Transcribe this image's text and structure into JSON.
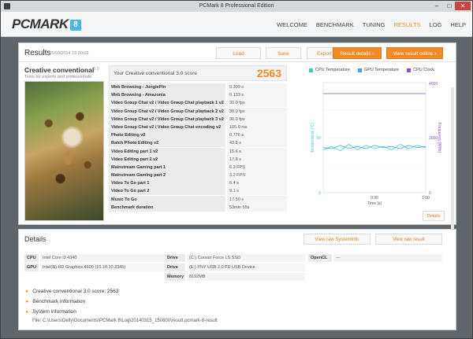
{
  "window": {
    "title": "PCMark 8 Professional Edition",
    "controls": {
      "minimize": "–",
      "maximize": "□",
      "close": "✕"
    }
  },
  "app": {
    "logo_text": "PCMARK",
    "logo_badge": "8",
    "nav": [
      "WELCOME",
      "BENCHMARK",
      "TUNING",
      "RESULTS",
      "LOG",
      "HELP"
    ],
    "active_nav": "RESULTS"
  },
  "results": {
    "heading": "Results",
    "date": "15/03/2014 16:00:03",
    "buttons": {
      "load": "Load",
      "save": "Save",
      "export": "Export",
      "result_details": "Result details",
      "view_online": "View result online"
    },
    "test_name": "Creative conventional",
    "test_version": "3.0",
    "test_subtitle": "Tests for experts and professionals",
    "score_label": "Your Creative conventional 3.0 score",
    "score_value": "2563",
    "rows": [
      {
        "name": "Web Browsing - JunglePin",
        "value": "0.309 s"
      },
      {
        "name": "Web Browsing - Amazonia",
        "value": "0.133 s"
      },
      {
        "name": "Video Group Chat v2 / Video Group Chat playback 1 v2",
        "value": "30.0 fps"
      },
      {
        "name": "Video Group Chat v2 / Video Group Chat playback 2 v2",
        "value": "30.0 fps"
      },
      {
        "name": "Video Group Chat v2 / Video Group Chat playback 3 v2",
        "value": "30.0 fps"
      },
      {
        "name": "Video Group Chat v2 / Video Group Chat encoding v2",
        "value": "105.0 ms"
      },
      {
        "name": "Photo Editing v2",
        "value": "0.776 s"
      },
      {
        "name": "Batch Photo Editing v2",
        "value": "43.8 s"
      },
      {
        "name": "Video Editing part 1 v2",
        "value": "15.6 s"
      },
      {
        "name": "Video Editing part 2 v2",
        "value": "17.8 s"
      },
      {
        "name": "Mainstream Gaming part 1",
        "value": "6.3 FPS"
      },
      {
        "name": "Mainstream Gaming part 2",
        "value": "3.2 FPS"
      },
      {
        "name": "Video To Go part 1",
        "value": "6.4 s"
      },
      {
        "name": "Video To Go part 2",
        "value": "9.1 s"
      },
      {
        "name": "Music To Go",
        "value": "17.50 s"
      },
      {
        "name": "Benchmark duration",
        "value": "53min 55s"
      }
    ],
    "details_button": "Details"
  },
  "chart_data": {
    "type": "line",
    "legend": [
      {
        "name": "CPU Temperature",
        "color": "#3ec9c9"
      },
      {
        "name": "GPU Temperature",
        "color": "#4aa3e0"
      },
      {
        "name": "CPU Clock",
        "color": "#8a4fc4"
      }
    ],
    "xlabel": "Time [s]",
    "ylabel_left": "Temperature [°C]",
    "ylabel_right": "Frequency [MHz]",
    "x_ticks": [
      "0:30",
      "1:00"
    ],
    "y_left_ticks": [
      "50",
      "0"
    ],
    "y_right_ticks": [
      "4000",
      "2000",
      "0"
    ],
    "ylim_left": [
      0,
      100
    ],
    "ylim_right": [
      0,
      4000
    ],
    "series": [
      {
        "name": "CPU Clock",
        "axis": "right",
        "x": [
          0,
          5,
          10,
          15,
          20,
          25,
          30,
          35,
          40,
          45,
          50,
          55,
          60
        ],
        "values": [
          3600,
          3600,
          3600,
          3600,
          3600,
          3600,
          3600,
          3600,
          3600,
          3600,
          3600,
          3600,
          3600
        ]
      },
      {
        "name": "CPU Temperature",
        "axis": "left",
        "x": [
          0,
          5,
          10,
          15,
          20,
          25,
          30,
          35,
          40,
          45,
          50,
          55,
          60
        ],
        "values": [
          39,
          42,
          38,
          44,
          39,
          43,
          40,
          42,
          39,
          44,
          40,
          43,
          41
        ]
      },
      {
        "name": "GPU Temperature",
        "axis": "left",
        "x": [
          0,
          5,
          10,
          15,
          20,
          25,
          30,
          35,
          40,
          45,
          50,
          55,
          60
        ],
        "values": [
          41,
          40,
          43,
          40,
          42,
          40,
          43,
          41,
          42,
          40,
          43,
          41,
          42
        ]
      }
    ]
  },
  "details": {
    "heading": "Details",
    "btn_sysinfo": "View raw SystemInfo",
    "btn_raw": "View raw result",
    "cpu_label": "CPU",
    "cpu_value": "Intel Core i3 4340",
    "gpu_label": "GPU",
    "gpu_value": "Intel(R) HD Graphics 4600 (10.18.10.3345)",
    "drive1_label": "Drive",
    "drive1_value": "(C:) Corsair Force LS SSD",
    "drive2_label": "Drive",
    "drive2_value": "(E:) PNY USB 2.0 FD USB Device",
    "memory_label": "Memory",
    "memory_value": "8192MB",
    "opencl_label": "OpenCL",
    "opencl_value": "—",
    "expand": [
      "Creative conventional 3.0 score: 2563",
      "Benchmark information",
      "System information"
    ],
    "file": "File: C:\\Users\\Delly\\Documents\\PCMark 8\\Log\\20140315_150600\\result.pcmark-8-result"
  }
}
